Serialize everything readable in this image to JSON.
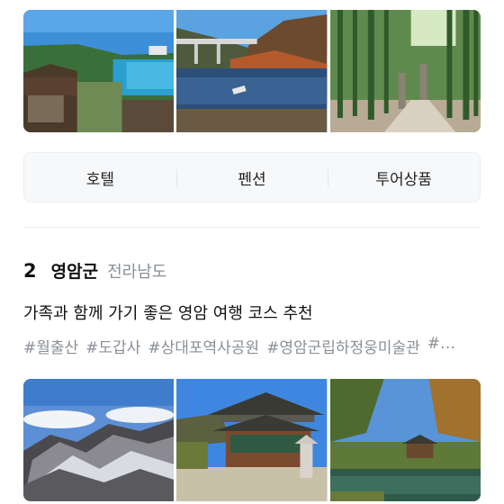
{
  "top_photos": [
    {
      "name": "coastal-village-photo"
    },
    {
      "name": "lake-bridge-photo"
    },
    {
      "name": "bamboo-forest-photo"
    }
  ],
  "tabs": [
    {
      "label": "호텔"
    },
    {
      "label": "펜션"
    },
    {
      "label": "투어상품"
    }
  ],
  "region": {
    "rank": "2",
    "name": "영암군",
    "province": "전라남도"
  },
  "description": "가족과 함께 가기 좋은 영암 여행 코스 추천",
  "tags": [
    "#월출산",
    "#도갑사",
    "#상대포역사공원",
    "#영암군립하정웅미술관",
    "#…"
  ],
  "bottom_photos": [
    {
      "name": "snowy-mountain-photo"
    },
    {
      "name": "temple-hall-photo"
    },
    {
      "name": "garden-pavilion-photo"
    }
  ]
}
